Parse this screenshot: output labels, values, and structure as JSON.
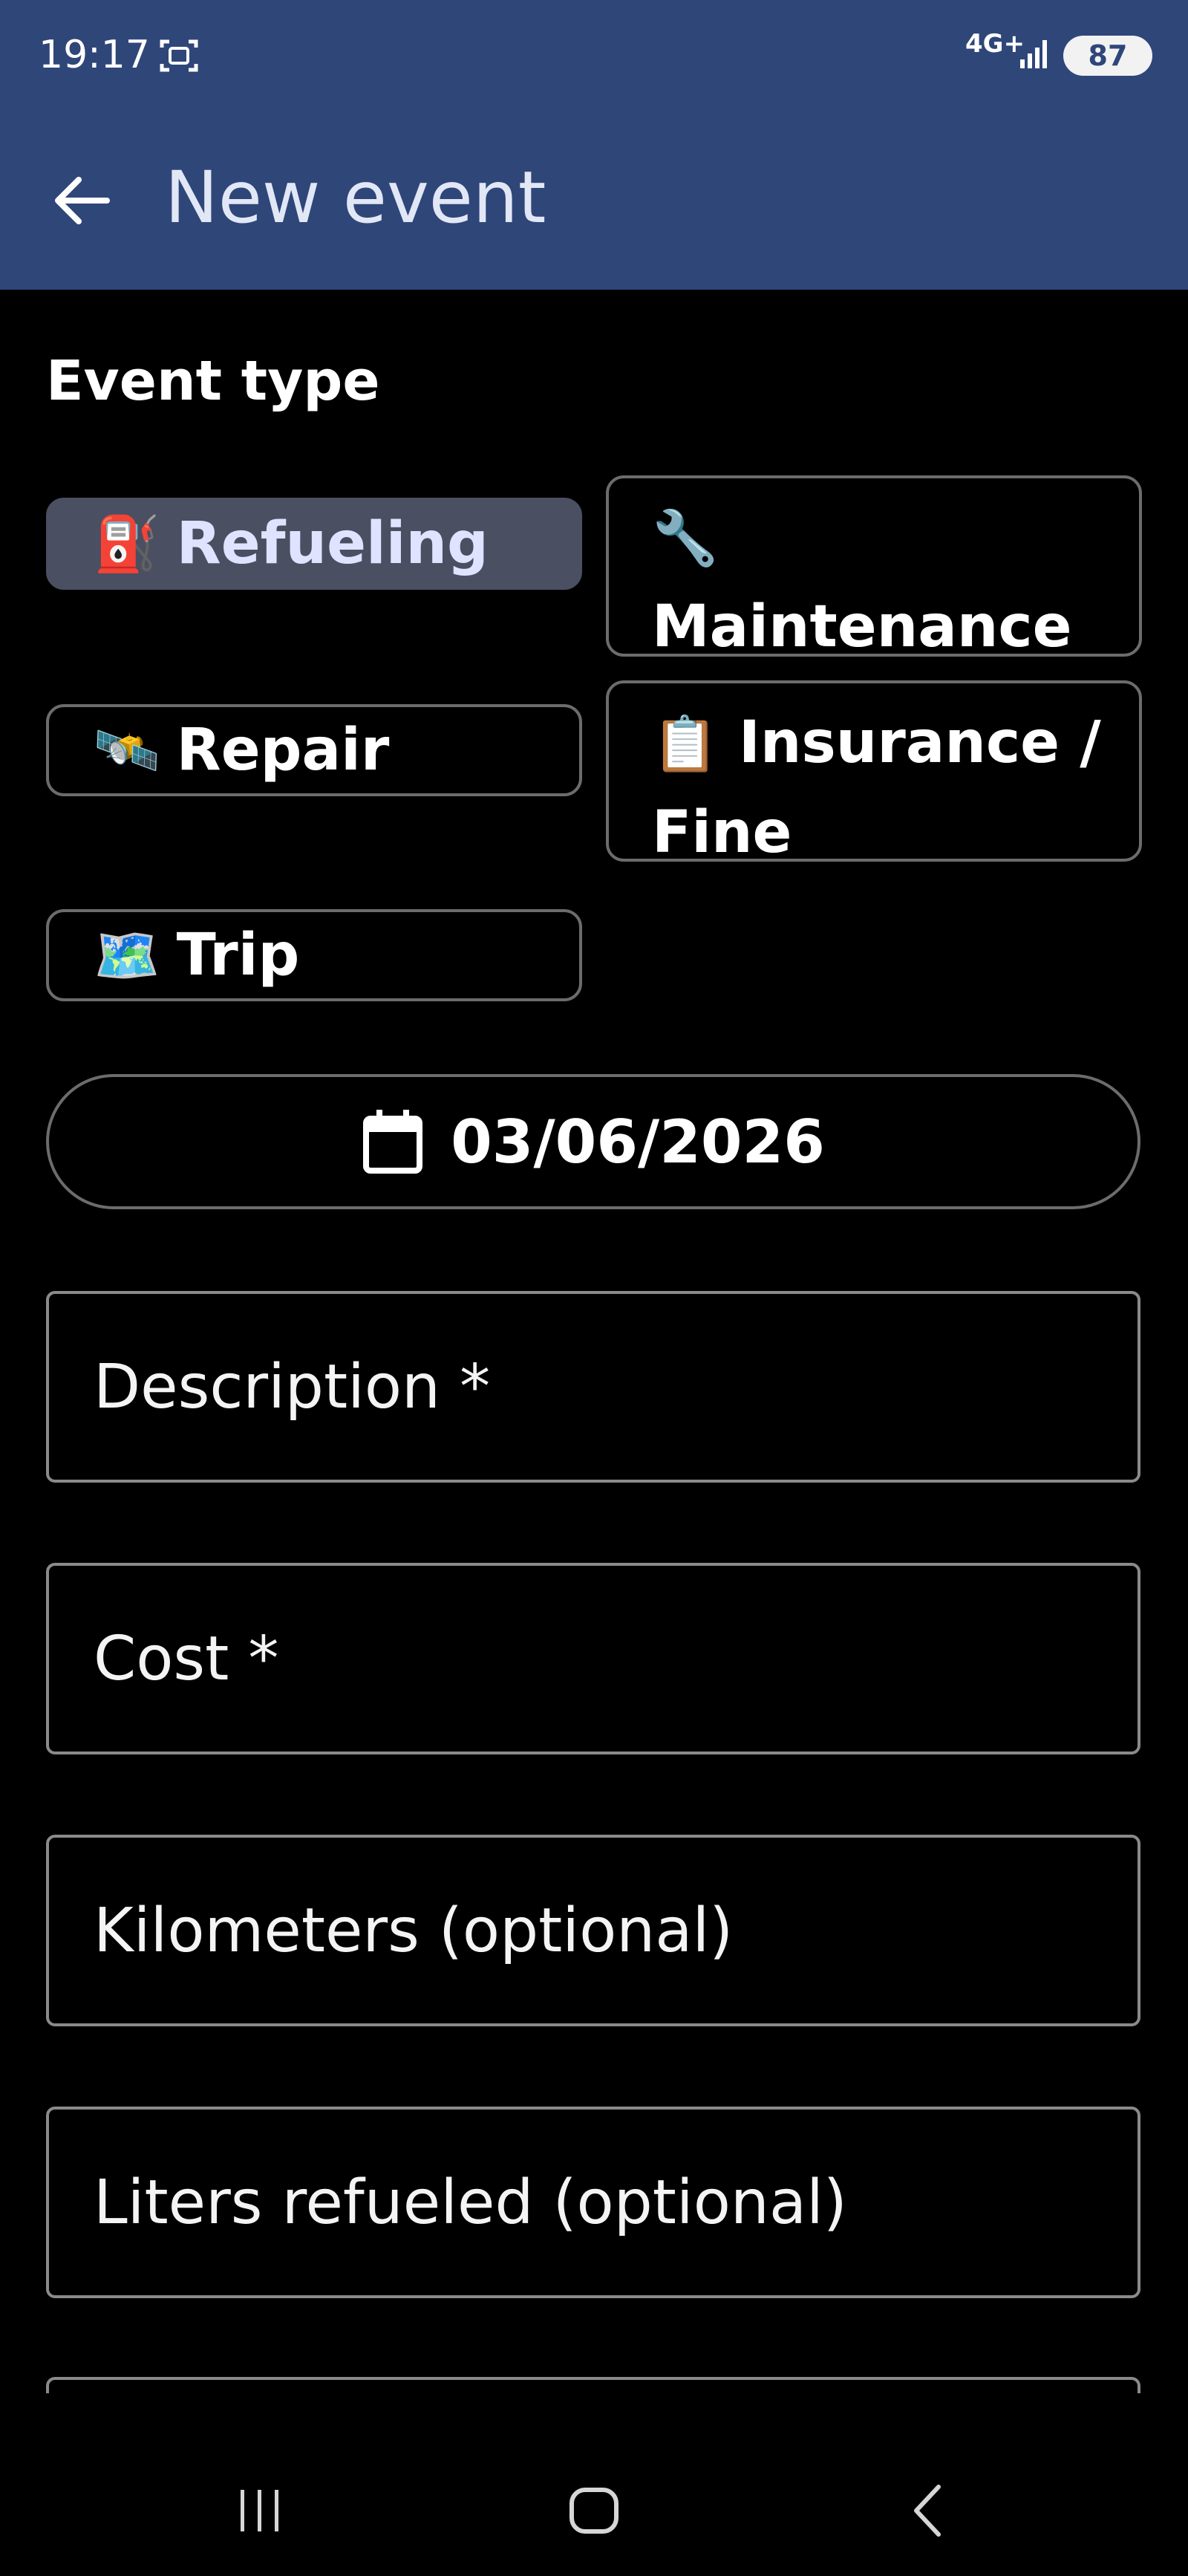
{
  "status_bar": {
    "time": "19:17",
    "network": "4G+",
    "battery": "87",
    "icons": [
      "screenshot-icon",
      "signal-icon",
      "battery-icon"
    ]
  },
  "app_bar": {
    "title": "New event",
    "back_icon": "arrow-left-icon"
  },
  "event_type": {
    "label": "Event type",
    "options": [
      {
        "emoji": "⛽",
        "label": "Refueling",
        "selected": true
      },
      {
        "emoji": "🔧",
        "label": "Maintenance",
        "selected": false
      },
      {
        "emoji": "🛰️",
        "label": "Repair",
        "selected": false
      },
      {
        "emoji": "📋",
        "label": "Insurance /",
        "label2": "Fine",
        "selected": false
      },
      {
        "emoji": "🗺️",
        "label": "Trip",
        "selected": false
      }
    ]
  },
  "date": {
    "value": "03/06/2026",
    "icon": "calendar-icon"
  },
  "fields": {
    "description": "Description *",
    "cost": "Cost *",
    "kilometers": "Kilometers (optional)",
    "liters": "Liters refueled (optional)"
  },
  "navigation_bar": {
    "icons": [
      "recent-apps-icon",
      "home-icon",
      "back-icon"
    ]
  },
  "colors": {
    "header": "#2f4679",
    "background": "#000000",
    "selected_chip": "#4a4f62",
    "outline": "#6c6c6e"
  }
}
